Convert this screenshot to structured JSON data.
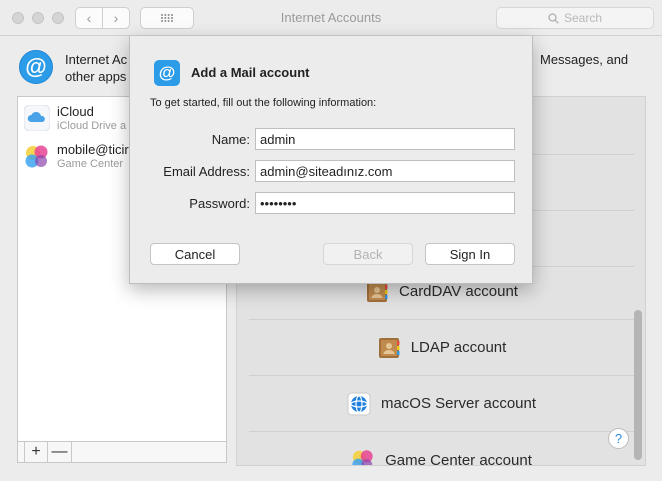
{
  "window": {
    "title": "Internet Accounts"
  },
  "search": {
    "placeholder": "Search"
  },
  "header": {
    "line1_left": "Internet Ac",
    "line2_left": "other apps",
    "line1_right": "Messages, and"
  },
  "accounts": [
    {
      "name": "iCloud",
      "subtitle": "iCloud Drive a",
      "icon": "icloud-icon"
    },
    {
      "name": "mobile@ticir",
      "subtitle": "Game Center",
      "icon": "game-center-icon"
    }
  ],
  "list_controls": {
    "add": "+",
    "remove": "—"
  },
  "providers": [
    {
      "label": "",
      "icon": ""
    },
    {
      "label": "",
      "icon": ""
    },
    {
      "label": "",
      "icon": ""
    },
    {
      "label": "CardDAV account",
      "icon": "contacts-book-icon"
    },
    {
      "label": "LDAP account",
      "icon": "contacts-book-icon"
    },
    {
      "label": "macOS Server account",
      "icon": "macos-server-icon"
    },
    {
      "label": "Game Center account",
      "icon": "game-center-icon"
    }
  ],
  "help": {
    "label": "?"
  },
  "dialog": {
    "title": "Add a Mail account",
    "instructions": "To get started, fill out the following information:",
    "fields": {
      "name": {
        "label": "Name:",
        "value": "admin"
      },
      "email": {
        "label": "Email Address:",
        "value": "admin@siteadınız.com"
      },
      "password": {
        "label": "Password:",
        "value": "password"
      }
    },
    "buttons": {
      "cancel": "Cancel",
      "back": "Back",
      "sign_in": "Sign In"
    }
  },
  "colors": {
    "accent": "#2c9be8",
    "window_bg": "#ececec",
    "panel_bg": "#e2e2e2"
  }
}
